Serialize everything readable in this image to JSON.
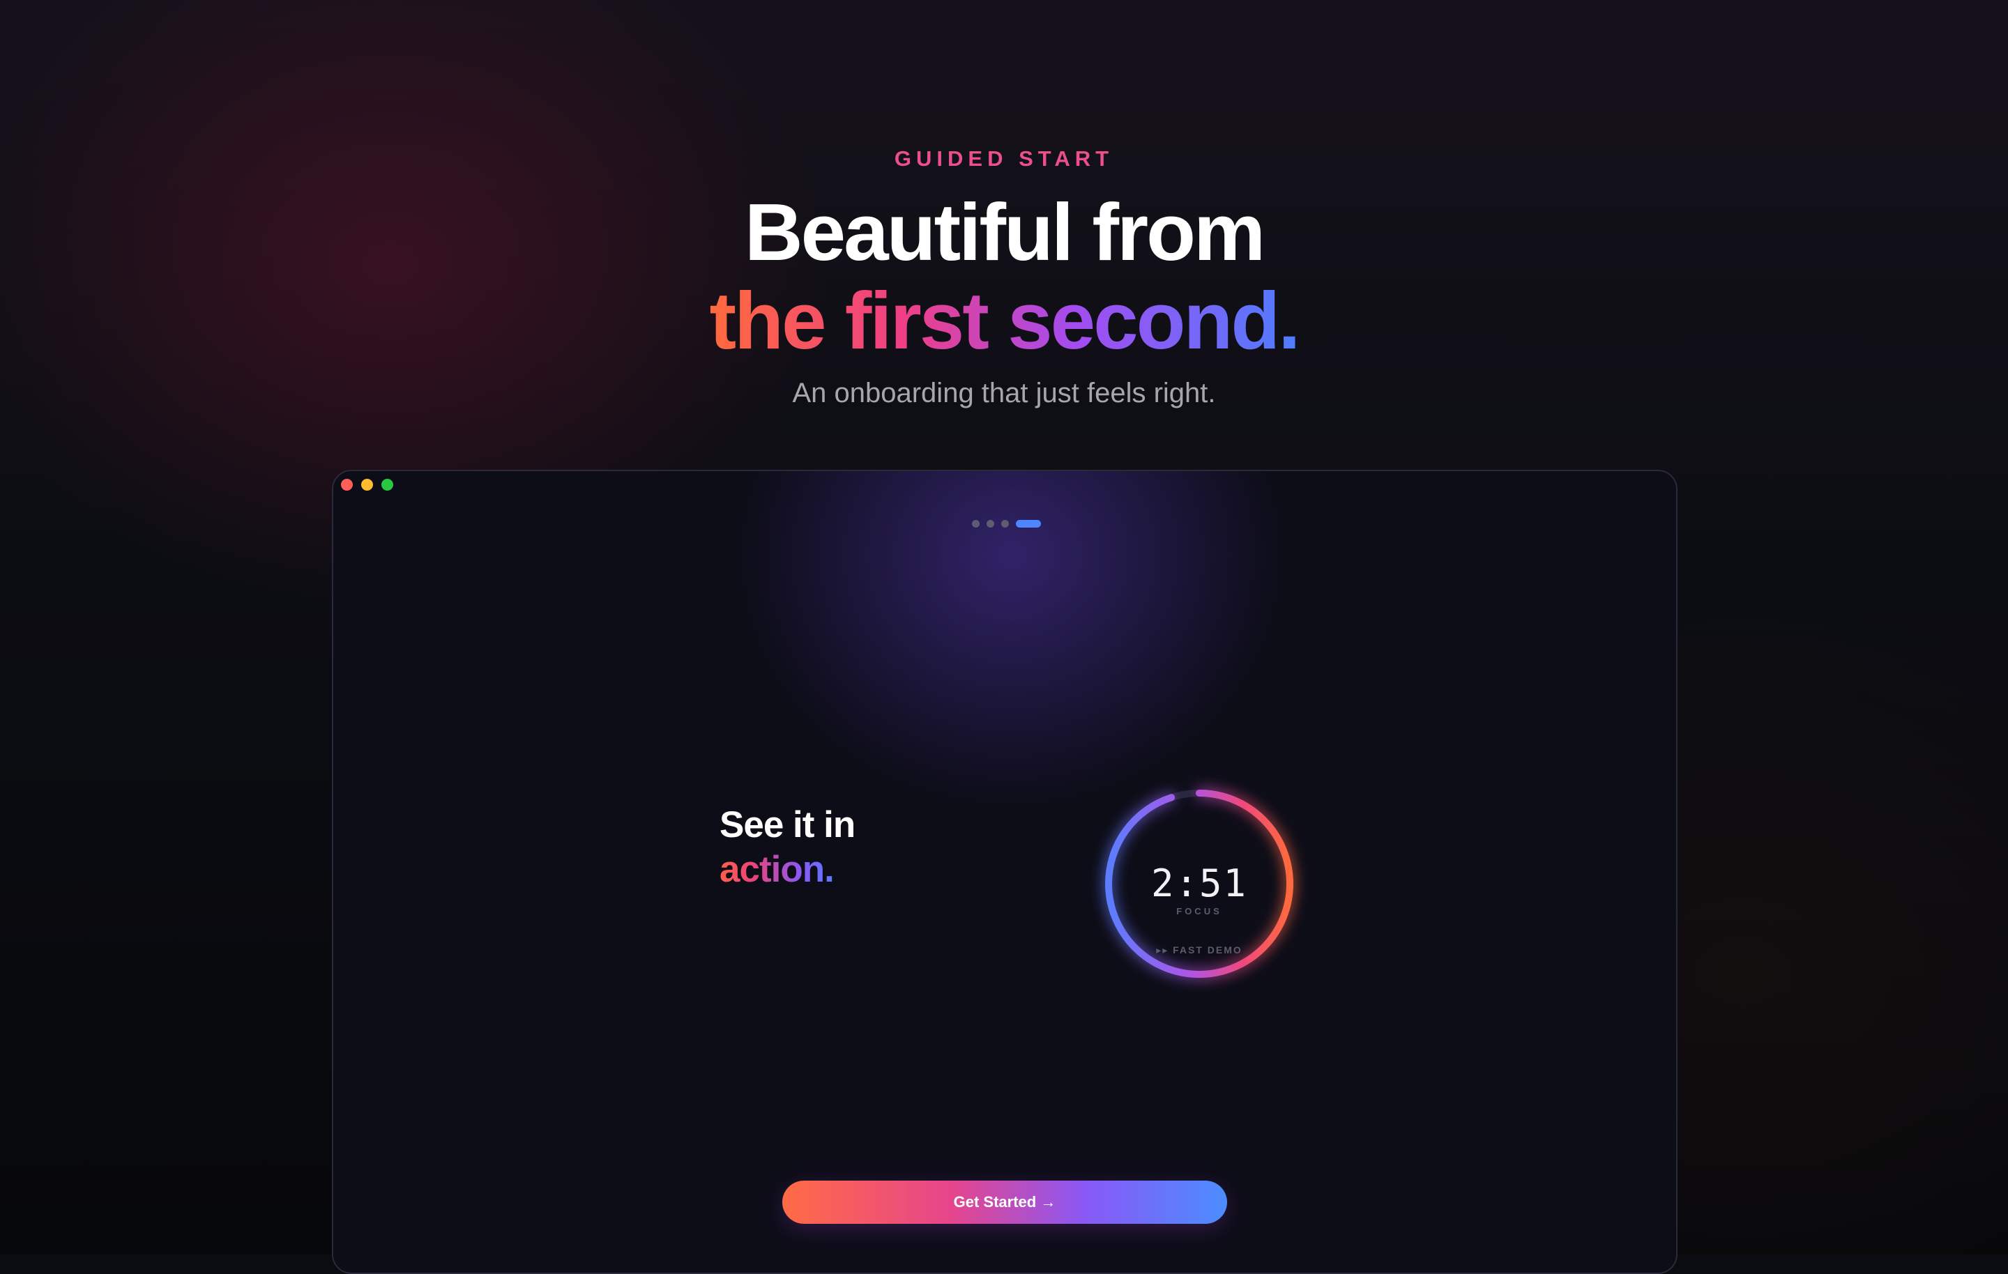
{
  "hero": {
    "eyebrow": "GUIDED START",
    "headline_line1": "Beautiful from",
    "headline_line2": "the first second.",
    "subtitle": "An onboarding that just feels right."
  },
  "window": {
    "traffic_lights": [
      "close",
      "minimize",
      "maximize"
    ],
    "page_indicator": {
      "total": 4,
      "active": 4
    },
    "feature_title_line1": "See it in",
    "feature_title_line2": "action.",
    "timer": {
      "time": "2:51",
      "label": "FOCUS",
      "progress": 0.95
    },
    "fast_demo": "▸▸ FAST DEMO",
    "cta_label": "Get Started →"
  },
  "colors": {
    "accent_pink": "#ec4f8c",
    "gradient_start": "#ff6a3d",
    "gradient_mid": "#a44cf0",
    "gradient_end": "#4f7dff",
    "background": "#0d0d18"
  }
}
